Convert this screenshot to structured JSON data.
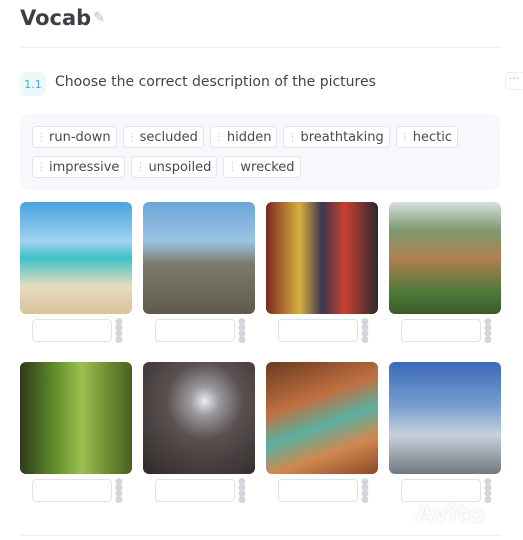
{
  "title": "Vocab",
  "edit_icon": "pencil-icon",
  "question": {
    "badge": "1.1",
    "text": "Choose the correct description of the pictures",
    "more": "···"
  },
  "word_bank": [
    "run-down",
    "secluded",
    "hidden",
    "breathtaking",
    "hectic",
    "impressive",
    "unspoiled",
    "wrecked"
  ],
  "pictures": [
    {
      "subject": "tropical beach",
      "answer": ""
    },
    {
      "subject": "stone ruin",
      "answer": ""
    },
    {
      "subject": "busy city street",
      "answer": ""
    },
    {
      "subject": "rock pillars mountains",
      "answer": ""
    },
    {
      "subject": "forest path",
      "answer": ""
    },
    {
      "subject": "ruined corridor",
      "answer": ""
    },
    {
      "subject": "underground cave",
      "answer": ""
    },
    {
      "subject": "modern building",
      "answer": ""
    }
  ],
  "watermark": "Avito"
}
